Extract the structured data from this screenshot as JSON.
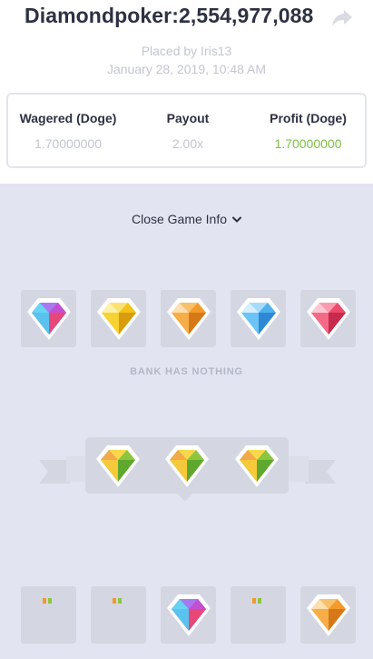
{
  "header": {
    "title": "Diamondpoker:2,554,977,088",
    "placed_by": "Placed by Iris13",
    "date": "January 28, 2019, 10:48 AM"
  },
  "stats": {
    "wagered_label": "Wagered (Doge)",
    "wagered_value": "1.70000000",
    "payout_label": "Payout",
    "payout_value": "2.00x",
    "profit_label": "Profit (Doge)",
    "profit_value": "1.70000000"
  },
  "game": {
    "close_label": "Close Game Info",
    "dealer_gems": [
      "purple-gem-icon",
      "yellow-gem-icon",
      "orange-gem-icon",
      "blue-gem-icon",
      "red-gem-icon"
    ],
    "bank_text": "BANK HAS NOTHING",
    "pair_gems": [
      "green-gem-icon",
      "green-gem-icon",
      "green-gem-icon"
    ],
    "player_slots": [
      "hidden",
      "hidden",
      "purple-gem-icon",
      "hidden",
      "orange-gem-icon"
    ]
  },
  "colors": {
    "accent_green": "#7bc043",
    "text_dark": "#2d3142",
    "text_muted": "#c2c6d0",
    "game_bg": "#e2e4f1",
    "tile_bg": "#d4d6e2"
  }
}
